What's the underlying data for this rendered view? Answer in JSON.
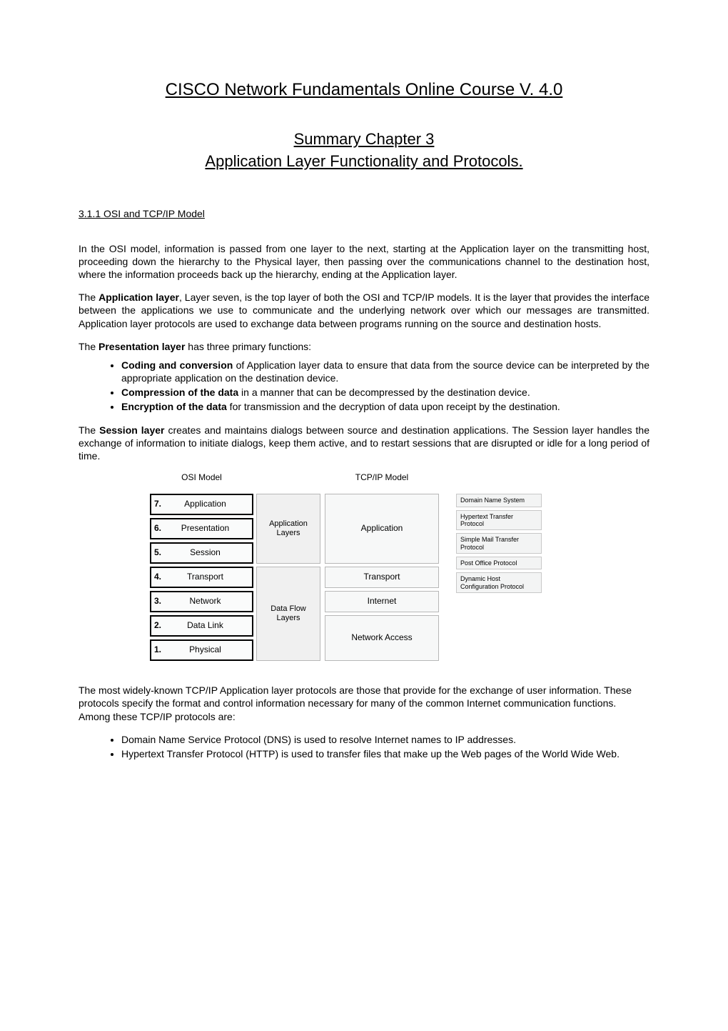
{
  "title": "CISCO Network Fundamentals Online Course V. 4.0",
  "subtitle1": "Summary Chapter 3",
  "subtitle2": "Application Layer Functionality and Protocols.",
  "section_heading": "3.1.1 OSI and TCP/IP Model",
  "para1": "In the OSI model, information is passed from one layer to the next, starting at the Application layer on the transmitting host, proceeding down the hierarchy to the Physical layer, then passing over the communications channel to the destination host, where the information proceeds back up the hierarchy, ending at the Application layer.",
  "para2_pre": "The ",
  "para2_bold": "Application layer",
  "para2_post": ", Layer seven, is the top layer of both the OSI and TCP/IP models. It is the layer that provides the interface between the applications we use to communicate and the underlying network over which our messages are transmitted. Application layer protocols are used to exchange data between programs running on the source and destination hosts.",
  "para3_pre": "The ",
  "para3_bold": "Presentation layer",
  "para3_post": " has three primary functions:",
  "functions": [
    {
      "bold": "Coding and conversion",
      "rest": " of Application layer data to ensure that data from the source device can be interpreted by the appropriate application on the destination device."
    },
    {
      "bold": "Compression of the data",
      "rest": " in a manner that can be decompressed by the destination device."
    },
    {
      "bold": "Encryption of the data",
      "rest": " for transmission and the decryption of data upon receipt by the destination."
    }
  ],
  "para4_pre": "The ",
  "para4_bold": "Session layer",
  "para4_post": " creates and maintains dialogs between source and destination applications. The Session layer handles the exchange of information to initiate dialogs, keep them active, and to restart sessions that are disrupted or idle for a long period of time.",
  "diagram": {
    "osi_header": "OSI Model",
    "tcp_header": "TCP/IP Model",
    "osi_layers": [
      {
        "n": "7.",
        "name": "Application"
      },
      {
        "n": "6.",
        "name": "Presentation"
      },
      {
        "n": "5.",
        "name": "Session"
      },
      {
        "n": "4.",
        "name": "Transport"
      },
      {
        "n": "3.",
        "name": "Network"
      },
      {
        "n": "2.",
        "name": "Data Link"
      },
      {
        "n": "1.",
        "name": "Physical"
      }
    ],
    "mid_app": "Application Layers",
    "mid_data": "Data Flow Layers",
    "tcp_layers": {
      "app": "Application",
      "transport": "Transport",
      "internet": "Internet",
      "network_access": "Network Access"
    },
    "protocols": [
      "Domain Name System",
      "Hypertext Transfer Protocol",
      "Simple Mail Transfer Protocol",
      "Post Office Protocol",
      "Dynamic Host Configuration Protocol"
    ]
  },
  "para5": "The most widely-known TCP/IP Application layer protocols are those that provide for the exchange of user information. These protocols specify the format and control information necessary for many of the common Internet communication functions. Among these TCP/IP protocols are:",
  "protocol_list": [
    "Domain Name Service Protocol (DNS) is used to resolve Internet names to IP addresses.",
    "Hypertext Transfer Protocol (HTTP) is used to transfer files that make up the Web pages of the World Wide Web."
  ]
}
